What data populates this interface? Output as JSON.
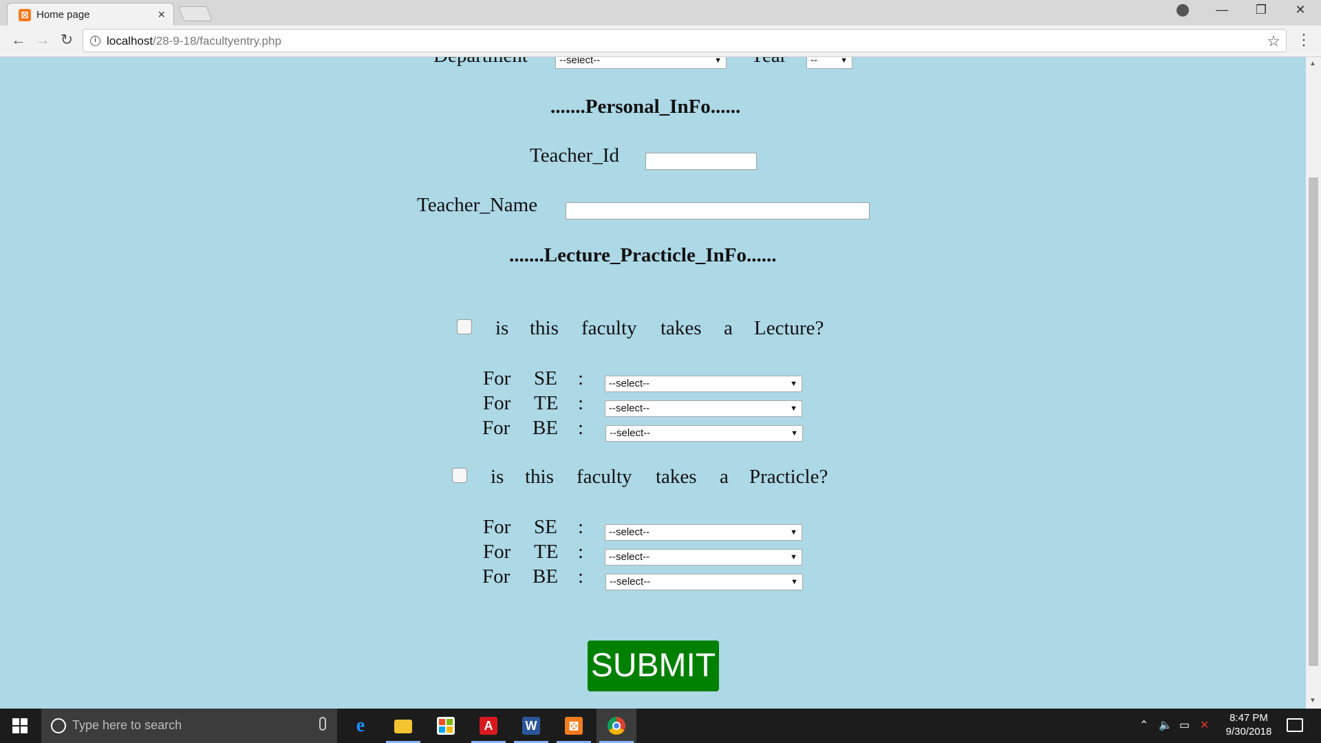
{
  "browser": {
    "tab_title": "Home page",
    "tab_close": "×",
    "url_host": "localhost",
    "url_path": "/28-9-18/facultyentry.php",
    "favicon_glyph": "☒"
  },
  "form": {
    "department_label": "Department",
    "department_value": "--select--",
    "year_label": "Year",
    "year_value": "--",
    "personal_heading": ".......Personal_InFo......",
    "teacher_id_label": "Teacher_Id",
    "teacher_id_value": "",
    "teacher_name_label": "Teacher_Name",
    "teacher_name_value": "",
    "lecture_heading": ".......Lecture_Practicle_InFo......",
    "lecture_question": [
      "is",
      "this",
      "faculty",
      "takes",
      "a",
      "Lecture?"
    ],
    "practicle_question": [
      "is",
      "this",
      "faculty",
      "takes",
      "a",
      "Practicle?"
    ],
    "for_word": "For",
    "colon": ":",
    "classes": [
      "SE",
      "TE",
      "BE"
    ],
    "select_default": "--select--",
    "submit_label": "SUBMIT"
  },
  "taskbar": {
    "search_placeholder": "Type here to search",
    "time": "8:47 PM",
    "date": "9/30/2018"
  },
  "icons": {
    "dropdown_arrow": "▼",
    "star": "☆",
    "menu": "⋮"
  }
}
